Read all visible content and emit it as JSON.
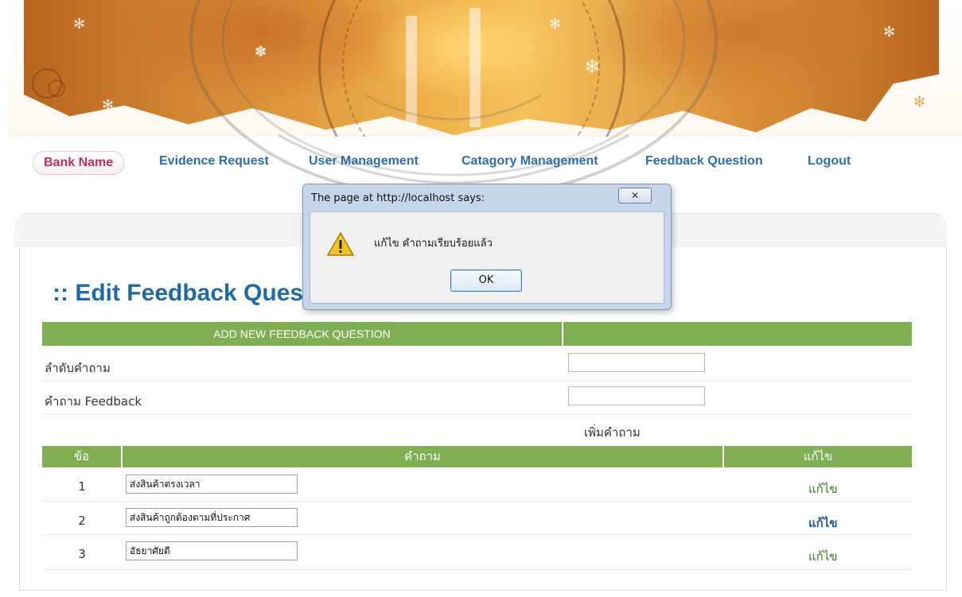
{
  "nav": {
    "items": [
      "Bank Name",
      "Evidence Request",
      "User Management",
      "Catagory Management",
      "Feedback Question",
      "Logout"
    ]
  },
  "page": {
    "title": ":: Edit Feedback Ques"
  },
  "add_form": {
    "header": "ADD NEW FEEDBACK QUESTION",
    "order_label": "ลำดับคำถาม",
    "question_label": "คำถาม Feedback",
    "order_value": "",
    "question_value": "",
    "add_link": "เพิ่มคำถาม"
  },
  "questions": {
    "headers": [
      "ข้อ",
      "คำถาม",
      "แก้ไข"
    ],
    "rows": [
      {
        "num": "1",
        "text": "ส่งสินค้าตรงเวลา",
        "edit": "แก้ไข"
      },
      {
        "num": "2",
        "text": "ส่งสินค้าถูกต้องตามที่ประกาศ",
        "edit": "แก้ไข"
      },
      {
        "num": "3",
        "text": "อัธยาศัยดี",
        "edit": "แก้ไข"
      }
    ]
  },
  "dialog": {
    "title": "The page at http://localhost says:",
    "message": "แก้ไข คำถามเรียบร้อยแล้ว",
    "ok": "OK",
    "icon": "warning-icon",
    "close_icon": "close-icon"
  },
  "colors": {
    "nav_link": "#2a6fb2",
    "active_nav": "#c0305a",
    "table_header": "#7faf52",
    "title": "#1e6aa6"
  }
}
